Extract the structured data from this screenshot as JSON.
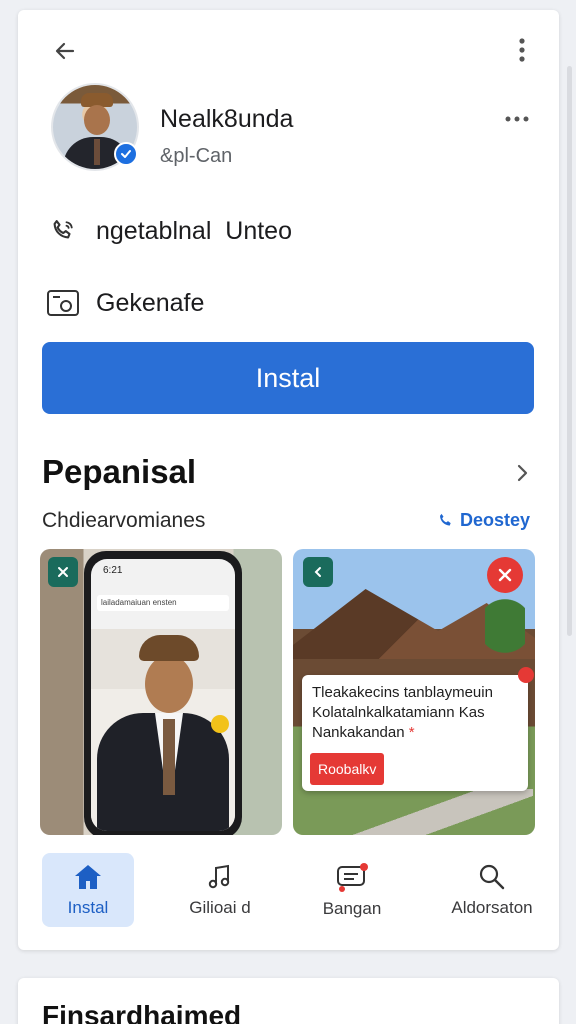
{
  "profile": {
    "name": "Nealk8unda",
    "handle": "&pl-Can"
  },
  "rows": {
    "phone_text": "ngetablnal  Unteo",
    "category_text": "Gekenafe"
  },
  "install_button": {
    "label": "Instal"
  },
  "section": {
    "title": "Pepanisal",
    "subtitle": "Chdiearvomianes",
    "action_label": "Deostey"
  },
  "screenshot1": {
    "status": "6:21",
    "url": "lailadamaiuan ensten"
  },
  "popup": {
    "line1": "Tleakakecins tanblaymeuin",
    "line2": "Kolatalnkalkatamiann Kas",
    "line3": "Nankakandan",
    "button_label": "Roobalkv"
  },
  "bottom_nav": [
    {
      "label": "Instal",
      "icon": "home-icon",
      "active": true
    },
    {
      "label": "Gilioai d",
      "icon": "music-note-icon",
      "active": false
    },
    {
      "label": "Bangan",
      "icon": "chat-icon",
      "active": false
    },
    {
      "label": "Aldorsaton",
      "icon": "search-icon",
      "active": false
    }
  ],
  "next_card": {
    "title": "Finsardhaimed"
  },
  "colors": {
    "accent": "#2a6fd6",
    "alert": "#e53935",
    "tag": "#1a6b5c"
  }
}
